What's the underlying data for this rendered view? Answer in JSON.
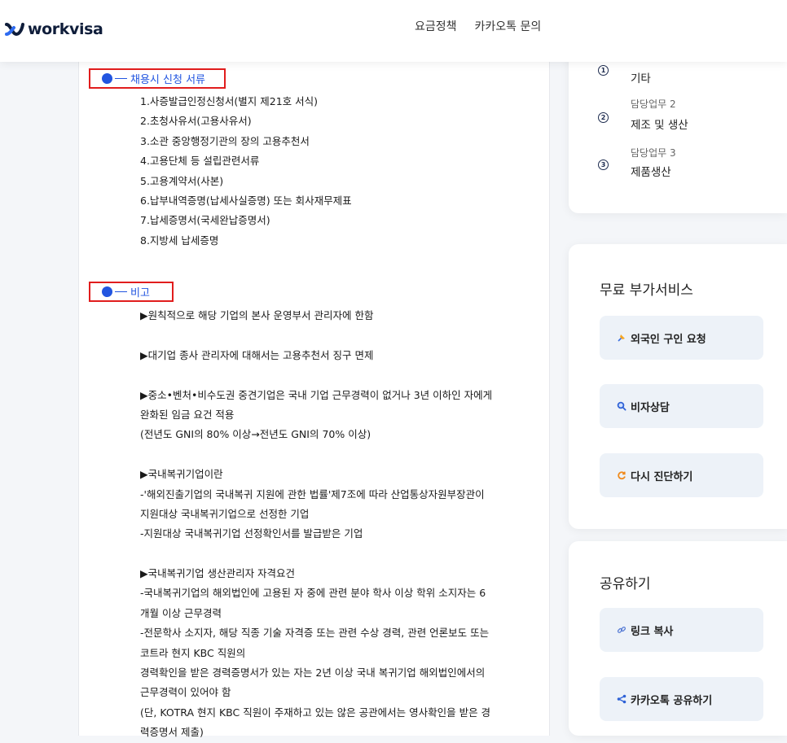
{
  "header": {
    "brand": "workvisa",
    "nav": [
      "요금정책",
      "카카오톡 문의"
    ]
  },
  "sections": {
    "documents": {
      "heading": "채용시 신청 서류",
      "items": [
        "1.사증발급인정신청서(별지 제21호 서식)",
        "2.초청사유서(고용사유서)",
        "3.소관 중앙행정기관의 장의 고용추천서",
        "4.고용단체 등 설립관련서류",
        "5.고용계약서(사본)",
        "6.납부내역증명(납세사실증명) 또는 회사재무제표",
        "7.납세증명서(국세완납증명서)",
        "8.지방세 납세증명"
      ]
    },
    "notes": {
      "heading": "비고",
      "lines": [
        "▶원칙적으로 해당 기업의 본사 운영부서 관리자에 한함",
        "",
        "▶대기업 종사 관리자에 대해서는 고용추천서 징구 면제",
        "",
        "▶중소•벤처•비수도권 중견기업은 국내 기업 근무경력이 없거나 3년 이하인 자에게",
        "완화된 임금 요건 적용",
        "(전년도 GNI의 80% 이상→전년도 GNI의 70% 이상)",
        "",
        "▶국내복귀기업이란",
        "-'해외진출기업의 국내복귀 지원에 관한 법률'제7조에 따라 산업통상자원부장관이",
        "지원대상 국내복귀기업으로 선정한 기업",
        "-지원대상 국내복귀기업 선정확인서를 발급받은 기업",
        "",
        "▶국내복귀기업 생산관리자 자격요건",
        "-국내복귀기업의 해외법인에 고용된 자 중에 관련 분야 학사 이상 학위 소지자는 6",
        "개월 이상 근무경력",
        "-전문학사 소지자, 해당 직종 기술 자격증 또는 관련 수상 경력, 관련 언론보도 또는",
        "코트라 현지 KBC 직원의",
        "경력확인을 받은 경력증명서가 있는 자는 2년 이상 국내 복귀기업 해외법인에서의",
        "근무경력이 있어야 함",
        "(단, KOTRA 현지 KBC 직원이 주재하고 있는 않은 공관에서는 영사확인을 받은 경",
        "력증명서 제출)"
      ]
    }
  },
  "sidebar": {
    "duties": [
      {
        "num": "1",
        "label": "",
        "value": "기타"
      },
      {
        "num": "2",
        "label": "담당업무 2",
        "value": "제조 및 생산"
      },
      {
        "num": "3",
        "label": "담당업무 3",
        "value": "제품생산"
      }
    ],
    "services": {
      "title": "무료 부가서비스",
      "buttons": [
        {
          "label": "외국인 구인 요청",
          "icon": "pin-icon"
        },
        {
          "label": "비자상담",
          "icon": "search-icon"
        },
        {
          "label": "다시 진단하기",
          "icon": "refresh-icon"
        }
      ]
    },
    "share": {
      "title": "공유하기",
      "buttons": [
        {
          "label": "링크 복사",
          "icon": "link-icon"
        },
        {
          "label": "카카오톡 공유하기",
          "icon": "share-icon"
        }
      ]
    }
  },
  "colors": {
    "accent_blue": "#2255e0",
    "highlight_red": "#e11d1d",
    "brand_navy": "#0f1d3a",
    "button_bg": "#edf2f8"
  }
}
